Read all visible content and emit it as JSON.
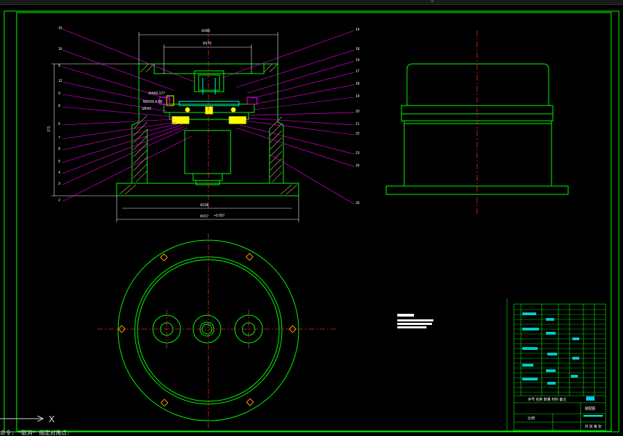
{
  "app": {
    "status_text": "日"
  },
  "ucs": {
    "x_label": "X"
  },
  "command": {
    "text": "命令: *取消* 指定对角点:"
  },
  "section_view": {
    "dims": {
      "top_width": "Φ350",
      "inner_width": "Φ170",
      "base_inner": "Φ238",
      "base_outer": "Φ317",
      "height": "171",
      "tol": "+0.057"
    },
    "left_leaders": [
      "15",
      "16",
      "8",
      "12",
      "9",
      "8",
      "6",
      "7",
      "8",
      "5",
      "4",
      "3",
      "2",
      "1"
    ],
    "right_leaders": [
      "14",
      "18",
      "19",
      "17",
      "18",
      "19",
      "20",
      "21",
      "22",
      "23",
      "24",
      "25"
    ],
    "callouts": [
      "BANS.177",
      "M8X20.4 B8",
      "SB/42"
    ]
  },
  "title_block": {
    "header": "序号 名称 数量 材料 备注",
    "drawing_name": "装配图",
    "company": "",
    "scale_label": "比例",
    "sheet_label": "共 张 第 张"
  },
  "notes": {
    "lines": [
      "技术要求",
      "1. 装配前零件清洗干净",
      "2. 各密封处不得渗漏"
    ]
  }
}
